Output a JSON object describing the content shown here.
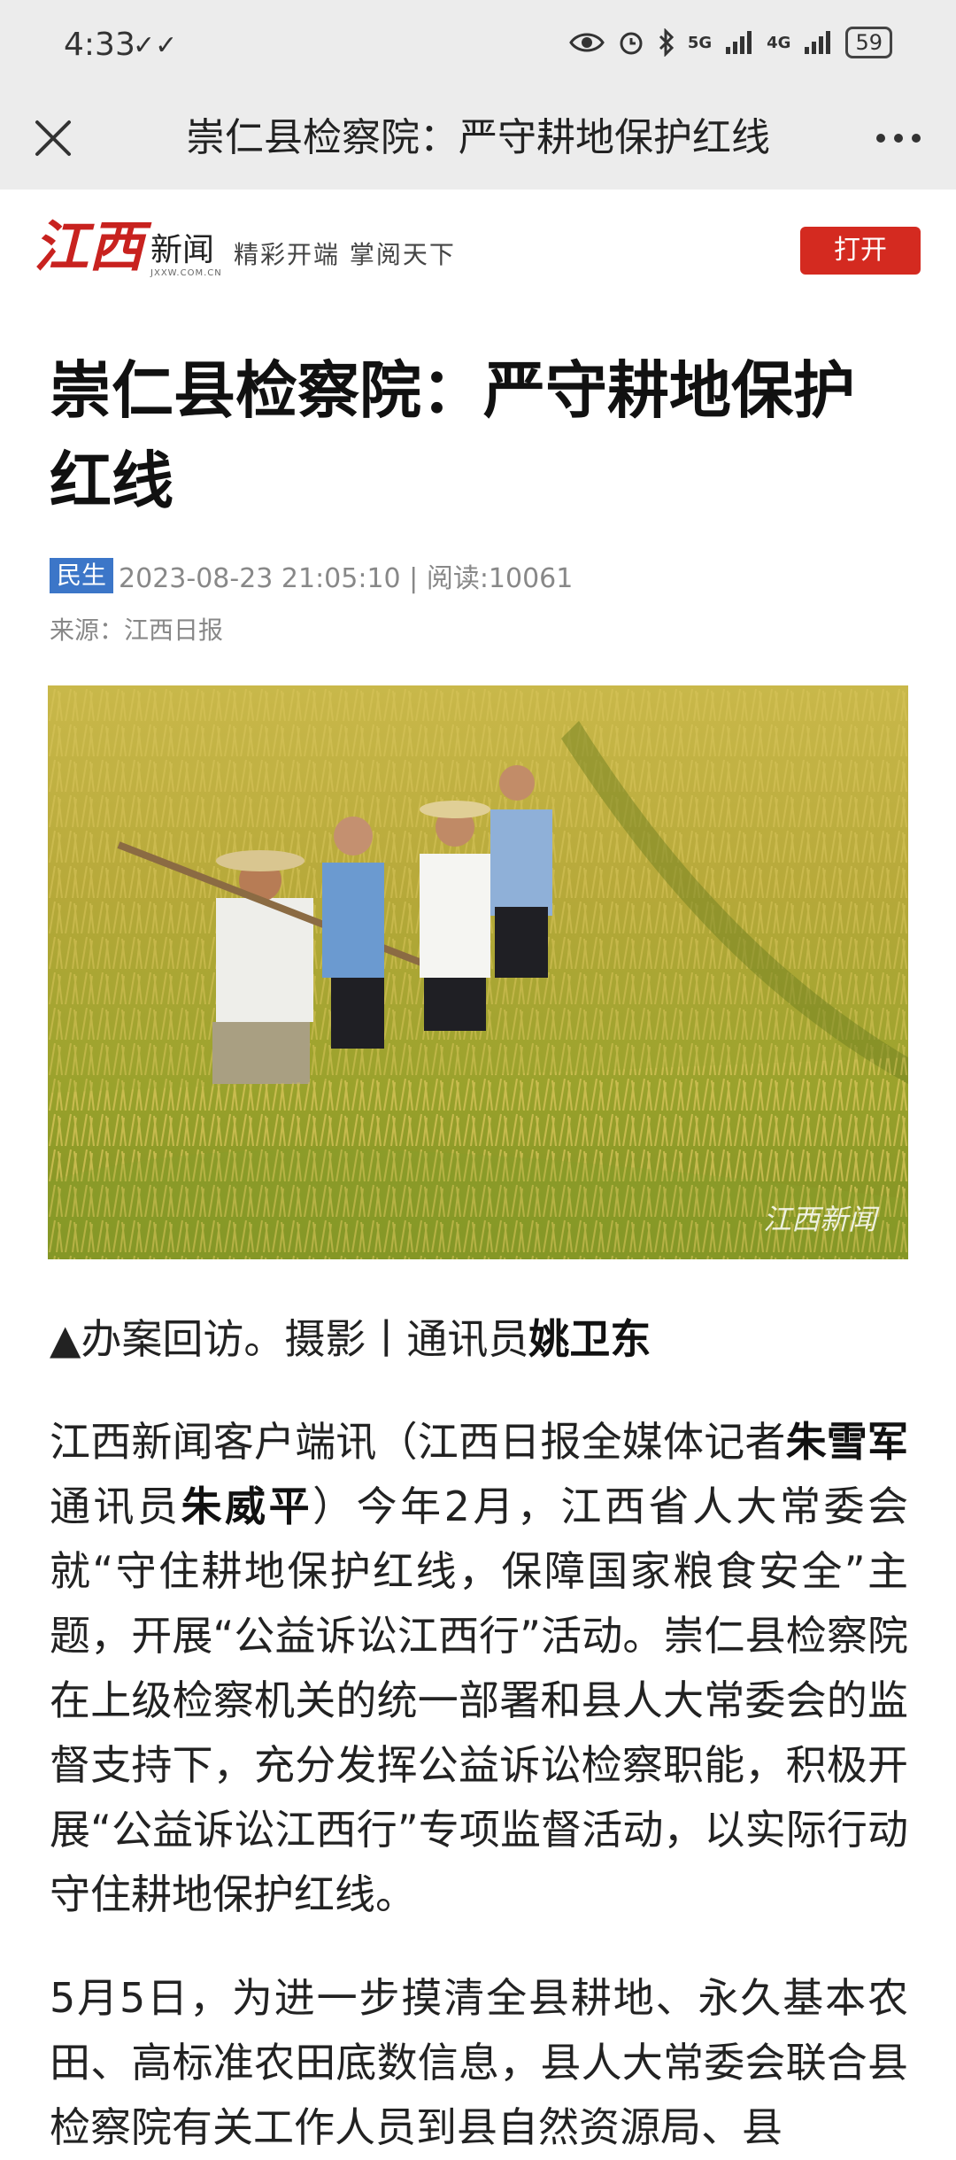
{
  "status_bar": {
    "time": "4:33",
    "battery": "59",
    "icons": [
      "eye-icon",
      "alarm-icon",
      "bluetooth-icon",
      "5g-signal-icon",
      "4g-signal-icon",
      "battery-icon"
    ],
    "network_5g": "5G",
    "network_4g": "4G"
  },
  "nav": {
    "title": "崇仁县检察院：严守耕地保护红线"
  },
  "brand": {
    "logo_script": "江西",
    "logo_cn": "新闻",
    "logo_url": "JXXW.COM.CN",
    "slogan": "精彩开端  掌阅天下",
    "open_button": "打开",
    "accent_color": "#d42a20"
  },
  "article": {
    "headline": "崇仁县检察院：严守耕地保护红线",
    "tag": "民生",
    "meta": "2023-08-23 21:05:10 | 阅读:10061",
    "source": "来源：江西日报",
    "photo_watermark": "江西新闻",
    "caption_prefix": "▲办案回访。摄影丨通讯员",
    "caption_name": "姚卫东",
    "p1_a": "江西新闻客户端讯（江西日报全媒体记者",
    "p1_name1": "朱雪军",
    "p1_b": " 通讯员",
    "p1_name2": "朱威平",
    "p1_c": "）今年2月，江西省人大常委会就“守住耕地保护红线，保障国家粮食安全”主题，开展“公益诉讼江西行”活动。崇仁县检察院在上级检察机关的统一部署和县人大常委会的监督支持下，充分发挥公益诉讼检察职能，积极开展“公益诉讼江西行”专项监督活动，以实际行动守住耕地保护红线。",
    "p2": "5月5日，为进一步摸清全县耕地、永久基本农田、高标准农田底数信息，县人大常委会联合县检察院有关工作人员到县自然资源局、县"
  }
}
